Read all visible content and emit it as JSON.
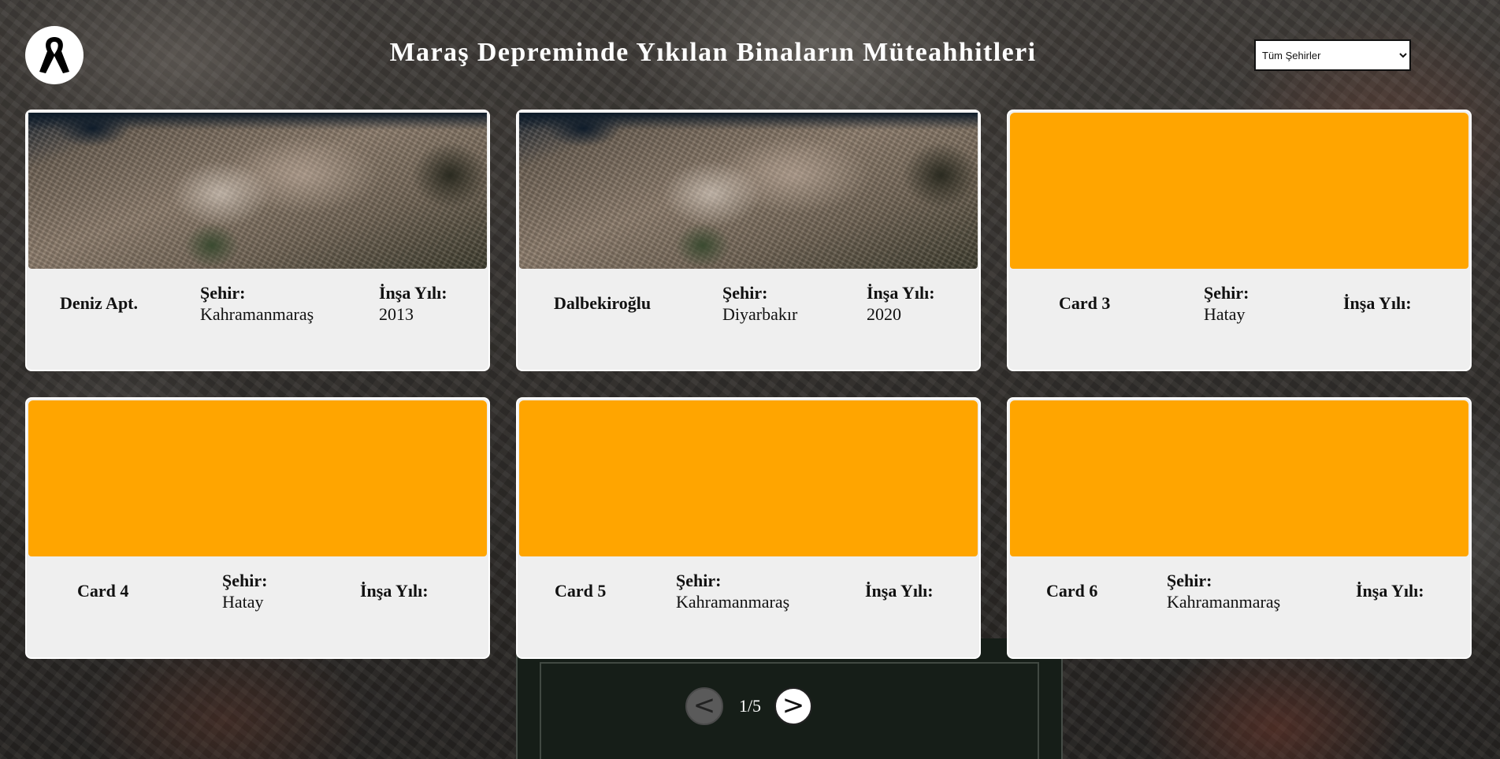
{
  "header": {
    "title": "Maraş Depreminde Yıkılan Binaların Müteahhitleri",
    "logo_icon": "black-ribbon-icon"
  },
  "filter": {
    "selected": "Tüm Şehirler",
    "options": [
      "Tüm Şehirler"
    ]
  },
  "labels": {
    "city": "Şehir:",
    "year": "İnşa Yılı:"
  },
  "cards": [
    {
      "name": "Deniz Apt.",
      "city": "Kahramanmaraş",
      "year": "2013",
      "image": "satellite-photo"
    },
    {
      "name": "Dalbekiroğlu",
      "city": "Diyarbakır",
      "year": "2020",
      "image": "satellite-photo"
    },
    {
      "name": "Card 3",
      "city": "Hatay",
      "year": "",
      "image": "placeholder"
    },
    {
      "name": "Card 4",
      "city": "Hatay",
      "year": "",
      "image": "placeholder"
    },
    {
      "name": "Card 5",
      "city": "Kahramanmaraş",
      "year": "",
      "image": "placeholder"
    },
    {
      "name": "Card 6",
      "city": "Kahramanmaraş",
      "year": "",
      "image": "placeholder"
    }
  ],
  "pagination": {
    "prev_label": "<",
    "next_label": ">",
    "page_info": "1/5"
  },
  "colors": {
    "placeholder": "#ffa500",
    "card_background": "#efefef"
  }
}
